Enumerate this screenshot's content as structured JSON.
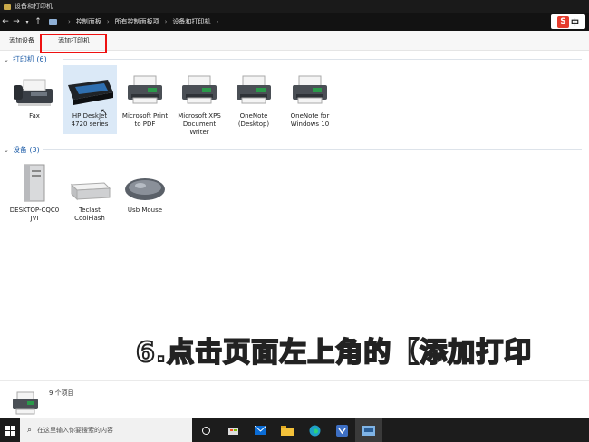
{
  "window": {
    "title": "设备和打印机"
  },
  "address": {
    "crumbs": [
      "控制面板",
      "所有控制面板项",
      "设备和打印机"
    ]
  },
  "ime": {
    "label": "中"
  },
  "command_bar": {
    "add_device": "添加设备",
    "add_printer": "添加打印机"
  },
  "printers_group": {
    "label": "打印机 (6)",
    "items": [
      {
        "line1": "Fax",
        "line2": "",
        "line3": ""
      },
      {
        "line1": "HP DeskJet",
        "line2": "4720 series",
        "line3": ""
      },
      {
        "line1": "Microsoft Print",
        "line2": "to PDF",
        "line3": ""
      },
      {
        "line1": "Microsoft XPS",
        "line2": "Document",
        "line3": "Writer"
      },
      {
        "line1": "OneNote",
        "line2": "(Desktop)",
        "line3": ""
      },
      {
        "line1": "OneNote for",
        "line2": "Windows 10",
        "line3": ""
      }
    ]
  },
  "devices_group": {
    "label": "设备 (3)",
    "items": [
      {
        "line1": "DESKTOP-CQC0",
        "line2": "JVI"
      },
      {
        "line1": "Teclast",
        "line2": "CoolFlash"
      },
      {
        "line1": "Usb Mouse",
        "line2": ""
      }
    ]
  },
  "caption": "6.点击页面左上角的【添加打印",
  "status": {
    "count_text": "9 个项目"
  },
  "taskbar": {
    "search_placeholder": "在这里输入你要搜索的内容"
  },
  "colors": {
    "accent": "#1e5da8",
    "highlight": "#e11111",
    "selection": "#dbe9f7"
  }
}
